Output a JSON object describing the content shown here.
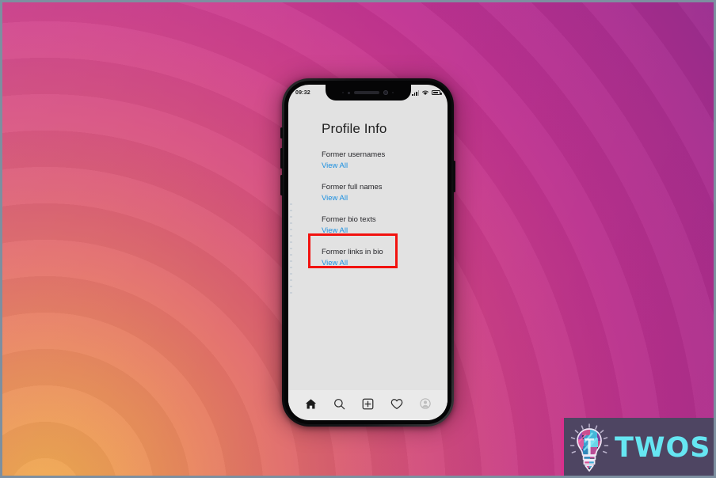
{
  "wallpaper": {
    "style": "concentric-rings-gradient",
    "colors": [
      "#f0ab4e",
      "#e47169",
      "#d8507f",
      "#c13392",
      "#9f2d92"
    ]
  },
  "phone": {
    "status_bar": {
      "clock": "09:32",
      "icons": [
        "signal-icon",
        "wifi-icon",
        "battery-icon"
      ]
    },
    "app": {
      "page_title": "Profile Info",
      "link_color": "#1a8fe0",
      "groups": [
        {
          "label": "Former usernames",
          "link": "View All"
        },
        {
          "label": "Former full names",
          "link": "View All"
        },
        {
          "label": "Former bio texts",
          "link": "View All"
        },
        {
          "label": "Former links in bio",
          "link": "View All"
        }
      ],
      "highlight": {
        "target_group": "Former bio texts",
        "border_color": "#f2120f"
      },
      "bottom_nav": [
        {
          "name": "home-icon",
          "active": true
        },
        {
          "name": "search-icon",
          "active": false
        },
        {
          "name": "add-post-icon",
          "active": false
        },
        {
          "name": "heart-icon",
          "active": false
        },
        {
          "name": "profile-avatar-icon",
          "active": false
        }
      ]
    }
  },
  "watermark": {
    "text": "TWOS",
    "icon": "lightbulb-icon",
    "background": "#4e4562",
    "text_color": "#66e6f2",
    "accent_strip": "#d8308c"
  }
}
